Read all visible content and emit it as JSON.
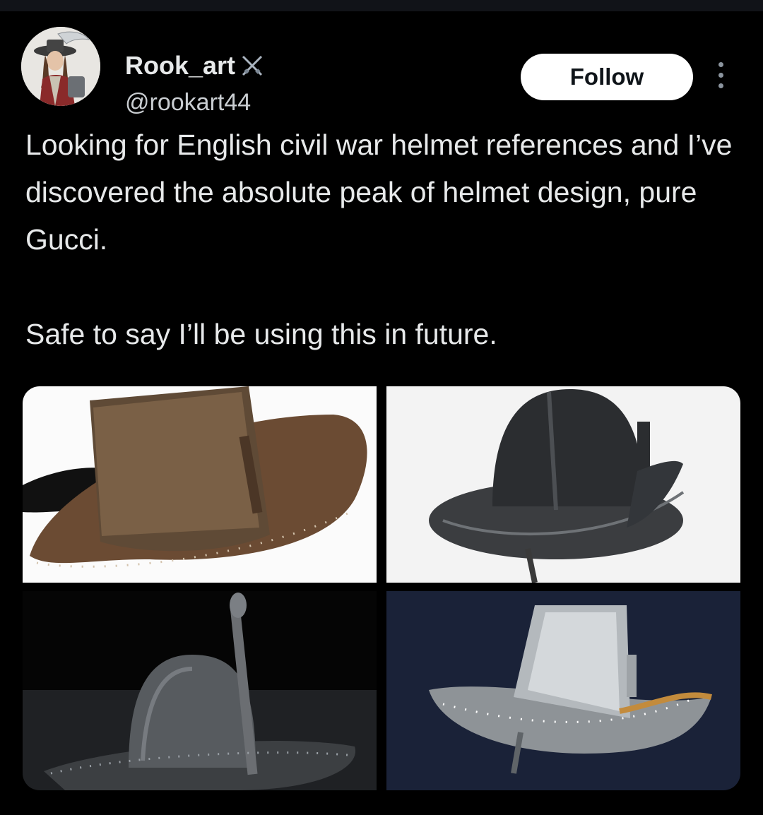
{
  "user": {
    "display_name": "Rook_art",
    "handle": "@rookart44",
    "badge_icon": "crossed-swords-icon"
  },
  "actions": {
    "follow_label": "Follow",
    "more_icon": "more-vertical-icon"
  },
  "tweet": {
    "paragraph_1": "Looking for English civil war helmet references and I’ve discovered the absolute peak of helmet design, pure Gucci.",
    "paragraph_2": "Safe to say I’ll be using this in future."
  },
  "media": {
    "image_count": 4,
    "images": [
      {
        "subject": "brown hat-shaped helmet with black feather"
      },
      {
        "subject": "dark iron lobster-pot helmet"
      },
      {
        "subject": "tall crown iron helmet with nasal bar"
      },
      {
        "subject": "polished steel hat helmet on blue cloth"
      }
    ]
  },
  "colors": {
    "background": "#000000",
    "text": "#e7e9ea",
    "follow_bg": "#ffffff"
  }
}
